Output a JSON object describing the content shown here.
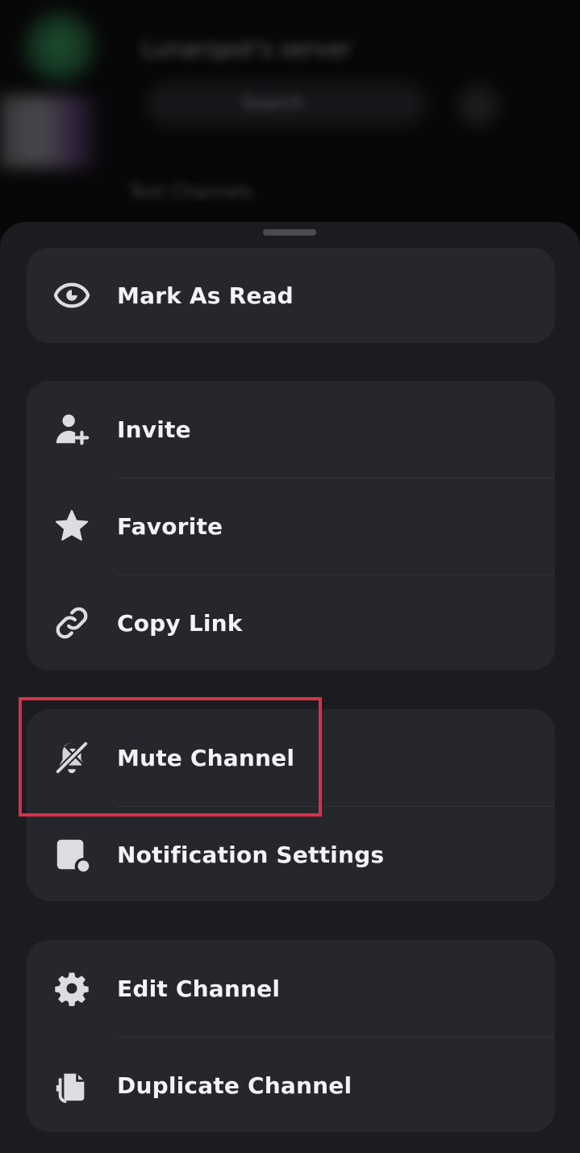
{
  "background": {
    "server_title": "Lunarspot's server",
    "search_text": "Search",
    "channel_text": "Text Channels"
  },
  "menu": {
    "groups": [
      {
        "items": [
          {
            "label": "Mark As Read",
            "icon": "eye-icon"
          }
        ]
      },
      {
        "items": [
          {
            "label": "Invite",
            "icon": "add-user-icon"
          },
          {
            "label": "Favorite",
            "icon": "star-icon"
          },
          {
            "label": "Copy Link",
            "icon": "link-icon"
          }
        ]
      },
      {
        "items": [
          {
            "label": "Mute Channel",
            "icon": "bell-slash-icon"
          },
          {
            "label": "Notification Settings",
            "icon": "notification-settings-icon"
          }
        ]
      },
      {
        "items": [
          {
            "label": "Edit Channel",
            "icon": "gear-icon"
          },
          {
            "label": "Duplicate Channel",
            "icon": "duplicate-icon"
          }
        ]
      }
    ]
  },
  "highlight": {
    "target": "Mute Channel",
    "color": "#d7314a"
  },
  "colors": {
    "sheet_bg": "#1b1c20",
    "group_bg": "#26272d",
    "text": "#f2f3f5"
  }
}
